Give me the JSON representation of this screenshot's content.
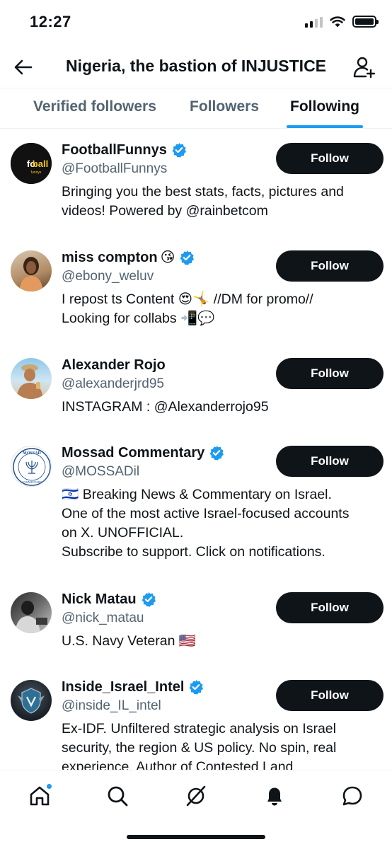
{
  "status_bar": {
    "time": "12:27"
  },
  "header": {
    "title": "Nigeria, the bastion of INJUSTICE"
  },
  "tabs": [
    {
      "label": "Verified followers",
      "active": false
    },
    {
      "label": "Followers",
      "active": false
    },
    {
      "label": "Following",
      "active": true
    }
  ],
  "colors": {
    "accent": "#1d9bf0",
    "button_bg": "#0f1419",
    "secondary_text": "#536471"
  },
  "users": [
    {
      "name": "FootballFunnys",
      "emoji": "",
      "verified": true,
      "handle": "@FootballFunnys",
      "bio_lines": [
        "Bringing you the best stats, facts, pictures and",
        "videos! Powered by @rainbetcom"
      ],
      "follow_label": "Follow",
      "avatar_text": "football",
      "avatar_subtext": "funnys"
    },
    {
      "name": "miss compton",
      "emoji": "😘",
      "verified": true,
      "handle": "@ebony_weluv",
      "bio_lines": [
        "I repost ts Content 😍🤸 //DM for promo//",
        "Looking for collabs 📲💬"
      ],
      "follow_label": "Follow"
    },
    {
      "name": "Alexander Rojo",
      "emoji": "",
      "verified": false,
      "handle": "@alexanderjrd95",
      "bio_lines": [
        "INSTAGRAM : @Alexanderrojo95"
      ],
      "follow_label": "Follow"
    },
    {
      "name": "Mossad Commentary",
      "emoji": "",
      "verified": true,
      "handle": "@MOSSADil",
      "bio_lines": [
        "🇮🇱 Breaking News & Commentary on Israel.",
        "One of the most active Israel-focused accounts",
        "on X. UNOFFICIAL.",
        "Subscribe to support. Click on notifications."
      ],
      "follow_label": "Follow",
      "avatar_text": "MOSSAD",
      "avatar_subtext": "COMMENTARY"
    },
    {
      "name": "Nick Matau",
      "emoji": "",
      "verified": true,
      "handle": "@nick_matau",
      "bio_lines": [
        "U.S. Navy Veteran 🇺🇸"
      ],
      "follow_label": "Follow"
    },
    {
      "name": "Inside_Israel_Intel",
      "emoji": "",
      "verified": true,
      "handle": "@inside_IL_intel",
      "bio_lines": [
        "Ex-IDF. Unfiltered strategic analysis on Israel",
        "security, the region & US policy. No spin, real",
        "experience. Author of Contested Land"
      ],
      "follow_label": "Follow"
    }
  ],
  "bottom_nav": [
    {
      "icon": "home-icon",
      "has_badge": true
    },
    {
      "icon": "search-icon",
      "has_badge": false
    },
    {
      "icon": "grok-icon",
      "has_badge": false
    },
    {
      "icon": "notifications-bell-icon",
      "has_badge": false
    },
    {
      "icon": "messages-icon",
      "has_badge": false
    }
  ]
}
